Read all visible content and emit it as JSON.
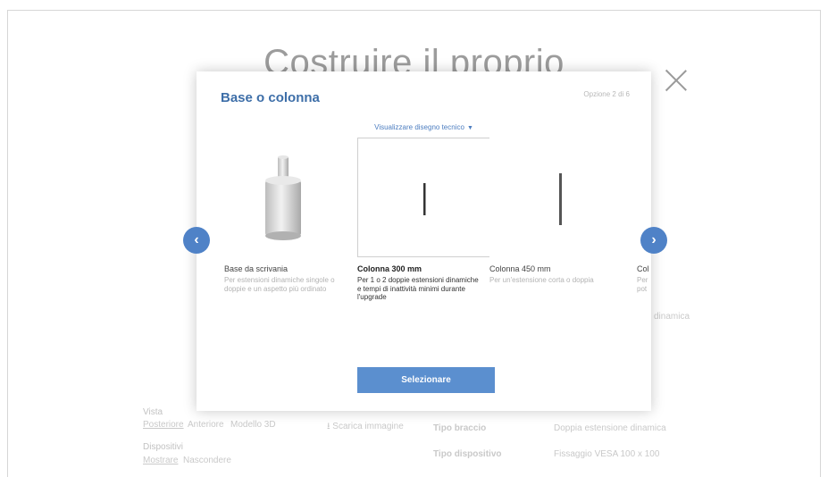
{
  "background": {
    "heading": "Costruire il proprio",
    "view_label": "Vista",
    "view_tabs": [
      "Posteriore",
      "Anteriore",
      "Modello 3D"
    ],
    "download_label": "Scarica immagine",
    "device_label": "Dispositivi",
    "device_tabs": [
      "Mostrare",
      "Nascondere"
    ],
    "spec_rows": [
      {
        "label": "Tipo braccio",
        "value": "Doppia estensione dinamica"
      },
      {
        "label": "Tipo dispositivo",
        "value": "Fissaggio VESA 100 x 100"
      }
    ],
    "side_text": "dinamica"
  },
  "modal": {
    "title": "Base o colonna",
    "step": "Opzione 2 di 6",
    "tech_link": "Visualizzare disegno tecnico",
    "select_label": "Selezionare",
    "options": [
      {
        "name": "Base da scrivania",
        "desc": "Per estensioni dinamiche singole o doppie e un aspetto più ordinato",
        "selected": false
      },
      {
        "name": "Colonna 300 mm",
        "desc": "Per 1 o 2 doppie estensioni dinamiche e tempi di inattività minimi durante l'upgrade",
        "selected": true
      },
      {
        "name": "Colonna 450 mm",
        "desc": "Per un'estensione corta o doppia",
        "selected": false
      },
      {
        "name": "Col",
        "desc": "Per",
        "desc2": "pot",
        "selected": false
      }
    ]
  },
  "icons": {
    "prev": "chevron-left-icon",
    "next": "chevron-right-icon",
    "close": "close-icon",
    "download": "download-icon"
  },
  "colors": {
    "accent": "#5b8fcf",
    "title": "#3d6ea8"
  }
}
